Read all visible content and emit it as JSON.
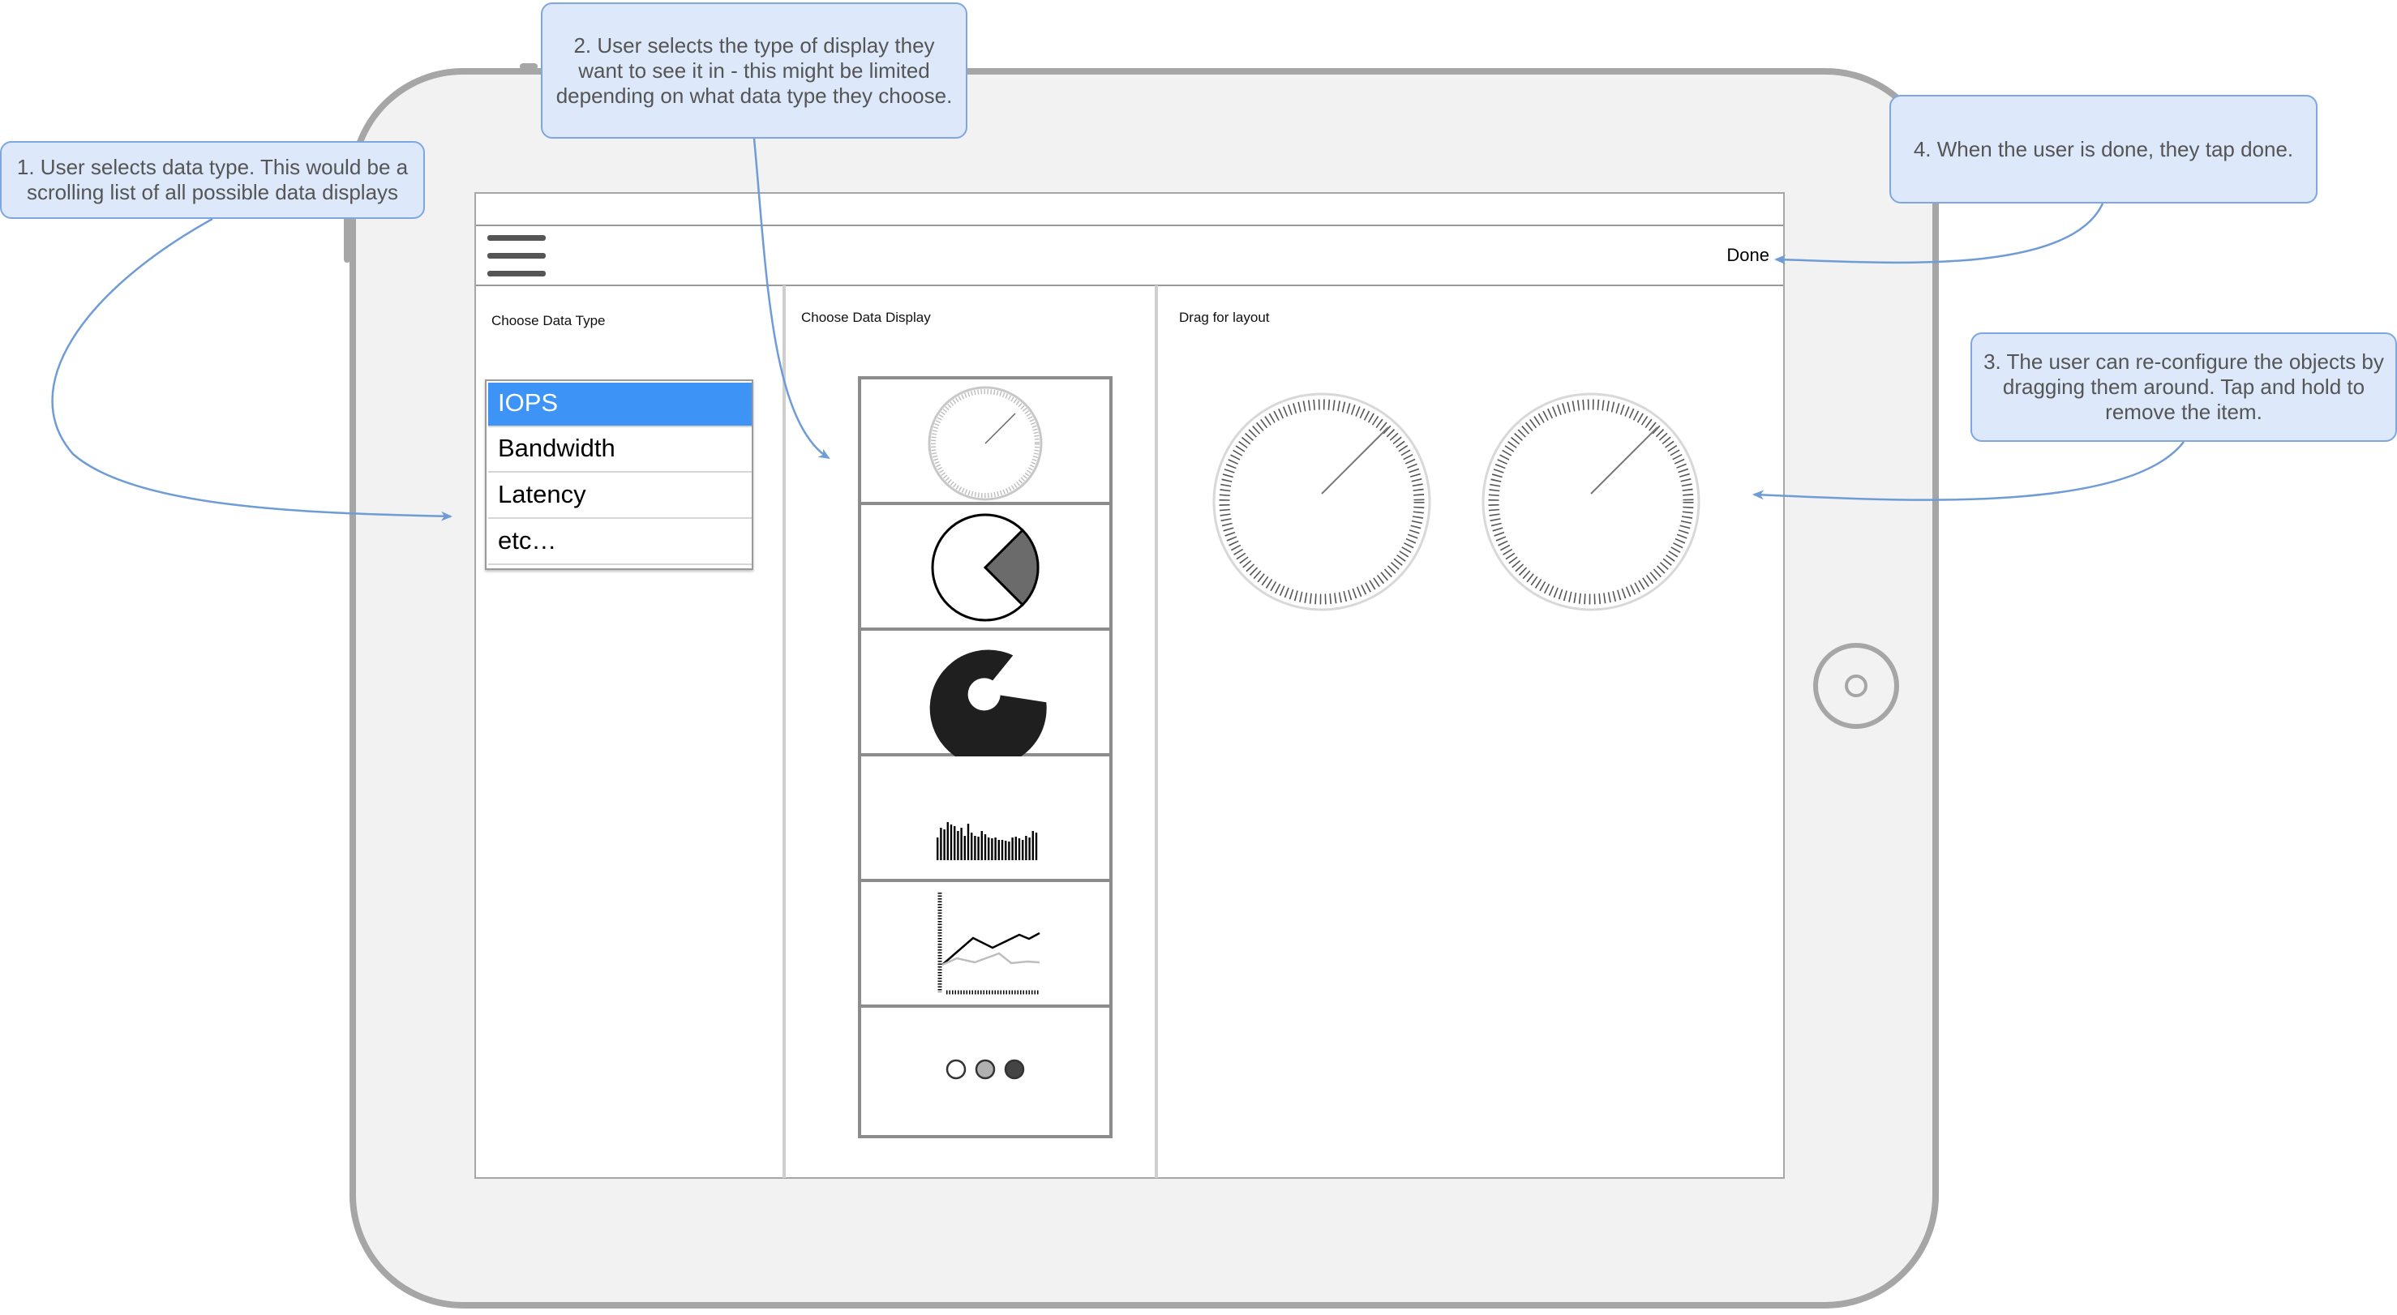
{
  "header": {
    "done_label": "Done"
  },
  "data_type_panel": {
    "title": "Choose Data Type",
    "items": [
      {
        "label": "IOPS",
        "selected": true
      },
      {
        "label": "Bandwidth",
        "selected": false
      },
      {
        "label": "Latency",
        "selected": false
      },
      {
        "label": "etc…",
        "selected": false
      }
    ]
  },
  "display_panel": {
    "title": "Choose Data Display",
    "options": [
      "gauge-icon",
      "pie-chart-icon",
      "donut-chart-icon",
      "bar-chart-icon",
      "line-chart-icon",
      "status-dots-icon"
    ]
  },
  "layout_panel": {
    "title": "Drag for layout",
    "placed_items": [
      "gauge-icon",
      "gauge-icon"
    ]
  },
  "annotations": [
    {
      "text": "1. User selects data type. This would be a scrolling list of all possible data displays"
    },
    {
      "text": "2. User selects the type of display they want to see it in - this might be limited depending on what data type they choose."
    },
    {
      "text": "3. The user can re-configure the objects by dragging them around. Tap and hold to remove the item."
    },
    {
      "text": "4. When the user is done, they tap done."
    }
  ],
  "colors": {
    "selection": "#3d94f6",
    "device_frame": "#a6a6a6",
    "callout_fill": "#dde9fa",
    "callout_border": "#7ea6e0"
  }
}
